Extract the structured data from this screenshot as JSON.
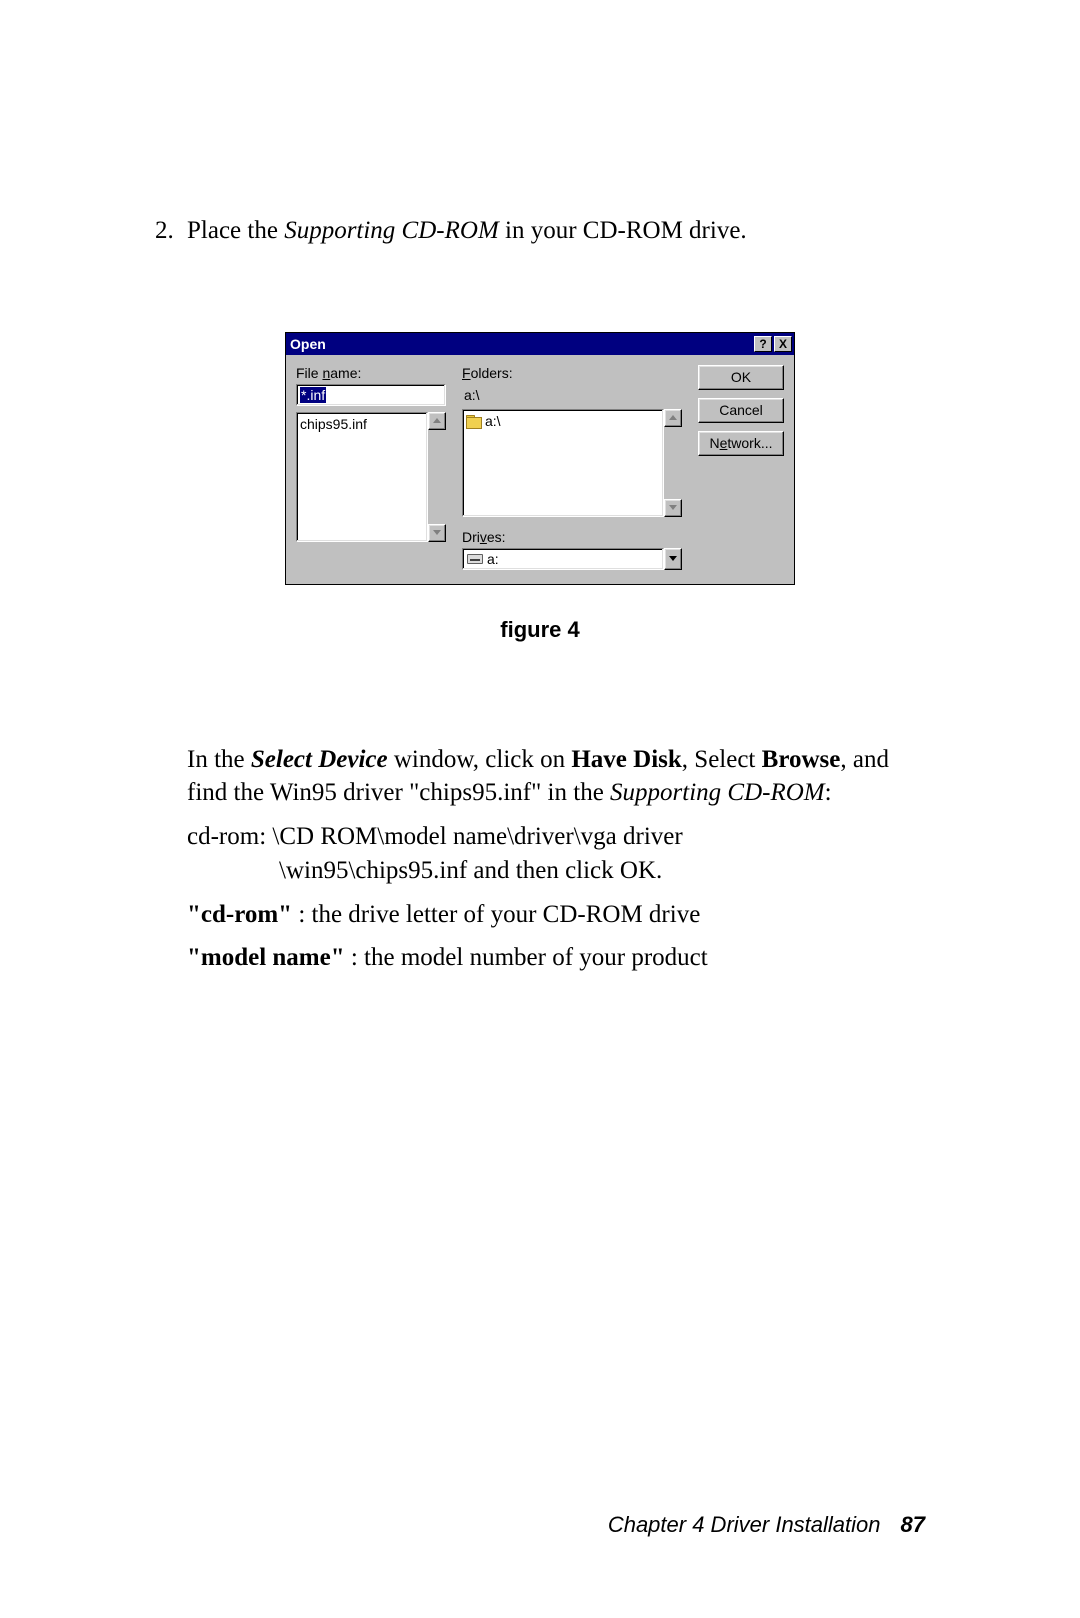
{
  "step": {
    "number": "2.",
    "prefix": "Place the ",
    "italic1": "Supporting CD-ROM",
    "suffix": " in your CD-ROM drive."
  },
  "dialog": {
    "title": "Open",
    "help_btn": "?",
    "close_btn": "X",
    "file_name_label_pre": "File ",
    "file_name_label_u": "n",
    "file_name_label_post": "ame:",
    "file_name_value": "*.inf",
    "folders_label_u": "F",
    "folders_label_post": "olders:",
    "folders_path": "a:\\",
    "file_list_item": "chips95.inf",
    "folder_list_item": "a:\\",
    "drives_label_pre": "Dri",
    "drives_label_u": "v",
    "drives_label_post": "es:",
    "drives_value": "a:",
    "ok": "OK",
    "cancel": "Cancel",
    "network_pre": "N",
    "network_u": "e",
    "network_post": "twork..."
  },
  "figure_label": "figure 4",
  "instructions": {
    "p1_pre": "In the ",
    "p1_i1": "Select Device",
    "p1_mid1": " window, click on ",
    "p1_b1": "Have Disk",
    "p1_mid2": ", Select ",
    "p1_b2": "Browse",
    "p1_mid3": ", and find the Win95 driver \"chips95.inf\" in the ",
    "p1_i2": "Supporting CD-ROM",
    "p1_end": ":",
    "p2_line1": "cd-rom: \\CD ROM\\model name\\driver\\vga driver",
    "p2_line2": "\\win95\\chips95.inf and then click OK.",
    "p3_b": "\"cd-rom\"",
    "p3_rest": " :  the drive letter of your CD-ROM drive",
    "p4_b": "\"model name\"",
    "p4_rest": "   :  the model number of your product"
  },
  "footer": {
    "chapter": "Chapter 4  Driver Installation",
    "page": "87"
  }
}
